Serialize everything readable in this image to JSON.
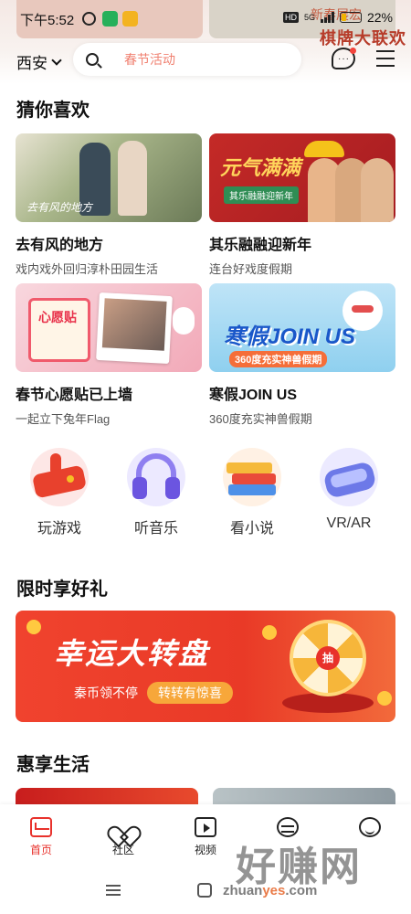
{
  "status_bar": {
    "time": "下午5:52",
    "hd": "HD",
    "network": "5G",
    "battery": "22%"
  },
  "header": {
    "city": "西安",
    "search_placeholder": "春节活动",
    "top_banner_text": "棋牌大联欢",
    "top_banner_text2": "新春展宏"
  },
  "guess_section": {
    "title": "猜你喜欢",
    "items": [
      {
        "title": "去有风的地方",
        "subtitle": "戏内戏外回归淳朴田园生活",
        "image_text": "去有风的地方"
      },
      {
        "title": "其乐融融迎新年",
        "subtitle": "连台好戏度假期",
        "image_text": "元气满满",
        "image_badge": "其乐融融迎新年"
      },
      {
        "title": "春节心愿贴已上墙",
        "subtitle": "一起立下兔年Flag",
        "image_text": "心愿贴"
      },
      {
        "title": "寒假JOIN US",
        "subtitle": "360度充实神兽假期",
        "image_text": "寒假JOIN US",
        "image_badge": "360度充实神兽假期"
      }
    ]
  },
  "features": [
    {
      "label": "玩游戏",
      "icon": "game-controller-icon"
    },
    {
      "label": "听音乐",
      "icon": "headphones-icon"
    },
    {
      "label": "看小说",
      "icon": "books-icon"
    },
    {
      "label": "VR/AR",
      "icon": "vr-goggles-icon"
    }
  ],
  "gift_section": {
    "title": "限时享好礼",
    "banner": {
      "title": "幸运大转盘",
      "subtitle": "秦币领不停",
      "cta": "转转有惊喜",
      "hub": "抽"
    }
  },
  "life_section": {
    "title": "惠享生活"
  },
  "tabbar": [
    {
      "label": "首页",
      "active": true
    },
    {
      "label": "社区",
      "active": false
    },
    {
      "label": "视频",
      "active": false
    },
    {
      "label": "",
      "active": false
    },
    {
      "label": "",
      "active": false
    }
  ],
  "watermark": {
    "main": "好赚网",
    "url_a": "zhuan",
    "url_b": "yes",
    "url_c": ".com"
  },
  "colors": {
    "accent": "#e8322c",
    "search_placeholder": "#f08070"
  }
}
